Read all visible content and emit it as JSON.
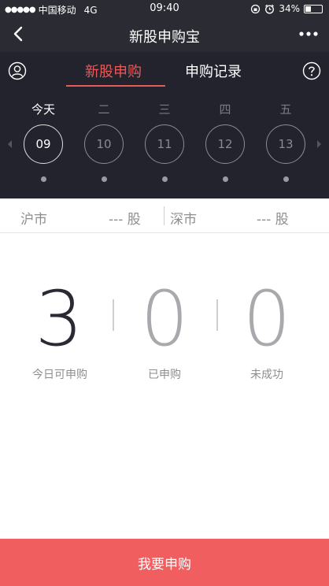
{
  "status": {
    "signal": "●●●●●",
    "carrier": "中国移动",
    "network": "4G",
    "time": "09:40",
    "battery": "34%",
    "battery_level": 0.34
  },
  "nav": {
    "title": "新股申购宝"
  },
  "tabs": [
    {
      "label": "新股申购"
    },
    {
      "label": "申购记录"
    }
  ],
  "days": [
    {
      "weekday": "今天",
      "date": "09"
    },
    {
      "weekday": "二",
      "date": "10"
    },
    {
      "weekday": "三",
      "date": "11"
    },
    {
      "weekday": "四",
      "date": "12"
    },
    {
      "weekday": "五",
      "date": "13"
    }
  ],
  "market": {
    "sh_label": "沪市",
    "sh_value": "--- 股",
    "sz_label": "深市",
    "sz_value": "--- 股"
  },
  "stats": [
    {
      "value": "3",
      "label": "今日可申购"
    },
    {
      "value": "0",
      "label": "已申购"
    },
    {
      "value": "0",
      "label": "未成功"
    }
  ],
  "action": {
    "apply_label": "我要申购"
  },
  "colors": {
    "accent": "#e85a5a",
    "button": "#f05e60",
    "header_bg": "#23232d"
  }
}
